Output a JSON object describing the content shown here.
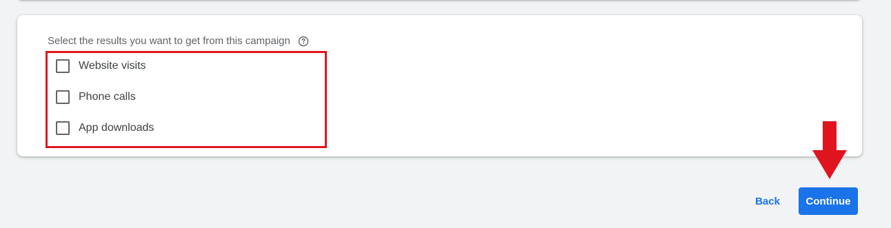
{
  "question": {
    "text": "Select the results you want to get from this campaign",
    "help_icon": "help-circle-icon"
  },
  "options": [
    {
      "label": "Website visits",
      "checked": false
    },
    {
      "label": "Phone calls",
      "checked": false
    },
    {
      "label": "App downloads",
      "checked": false
    }
  ],
  "footer": {
    "back_label": "Back",
    "continue_label": "Continue"
  },
  "colors": {
    "highlight": "#e0141e",
    "accent": "#1a73e8",
    "background": "#f1f3f4"
  }
}
